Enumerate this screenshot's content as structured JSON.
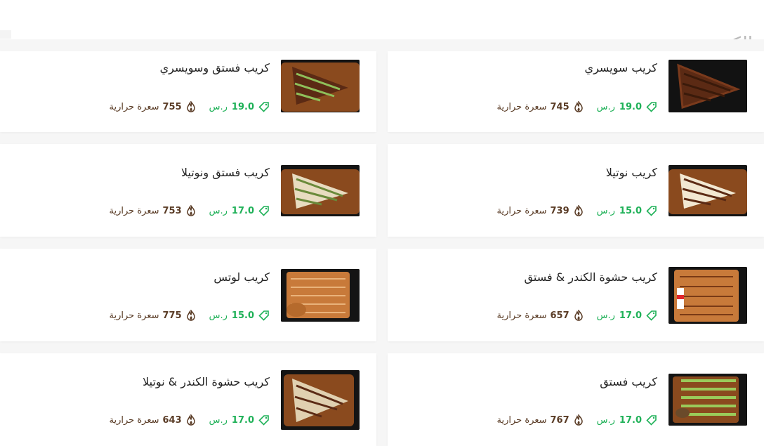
{
  "section": {
    "title": "الكريب"
  },
  "labels": {
    "currency": "ر.س",
    "calories_unit": "سعرة حرارية"
  },
  "colors": {
    "price_green": "#1fb158",
    "calorie_brown": "#5a3c26",
    "title_gray": "#b9b9b9"
  },
  "items": [
    {
      "name": "كريب سويسري",
      "price": "19.0",
      "calories": "745",
      "image": "swiss-crepe"
    },
    {
      "name": "كريب فستق وسويسري",
      "price": "19.0",
      "calories": "755",
      "image": "pistachio-swiss-crepe"
    },
    {
      "name": "كريب نوتيلا",
      "price": "15.0",
      "calories": "739",
      "image": "nutella-crepe"
    },
    {
      "name": "كريب فستق ونوتيلا",
      "price": "17.0",
      "calories": "753",
      "image": "pistachio-nutella-crepe"
    },
    {
      "name": "كريب حشوة الكندر & فستق",
      "price": "17.0",
      "calories": "657",
      "image": "kinder-pistachio-crepe"
    },
    {
      "name": "كريب لوتس",
      "price": "15.0",
      "calories": "775",
      "image": "lotus-crepe"
    },
    {
      "name": "كريب فستق",
      "price": "17.0",
      "calories": "767",
      "image": "pistachio-crepe"
    },
    {
      "name": "كريب حشوة الكندر & نوتيلا",
      "price": "17.0",
      "calories": "643",
      "image": "kinder-nutella-crepe"
    }
  ]
}
